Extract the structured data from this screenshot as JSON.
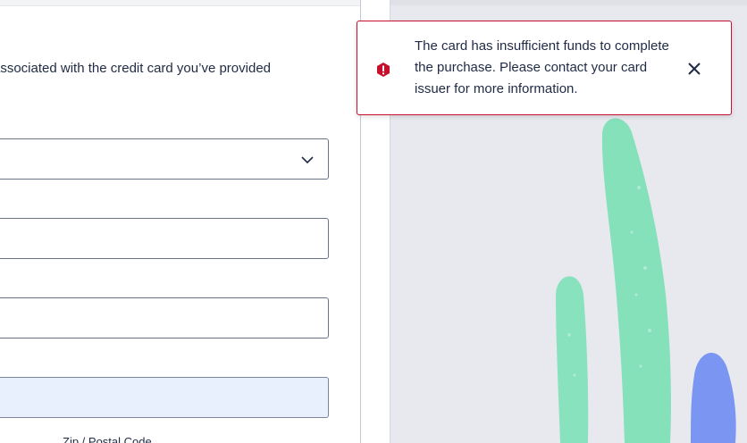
{
  "form": {
    "description": "associated with the credit card you’ve provided",
    "zip_label": "Zip / Postal Code"
  },
  "toast": {
    "message": "The card has insufficient funds to complete the purchase. Please contact your card issuer for more information.",
    "icon": "error-icon",
    "close_icon": "close-icon",
    "accent": "#c8102e"
  },
  "decor": {
    "plant_green": "#7fe0b6",
    "plant_blue": "#7b96f2"
  }
}
